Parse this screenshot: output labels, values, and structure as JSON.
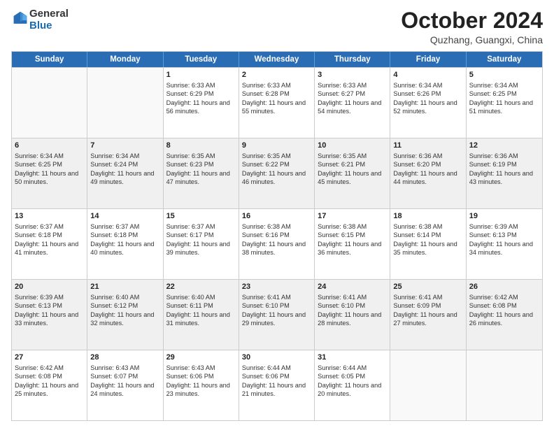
{
  "header": {
    "logo": {
      "general": "General",
      "blue": "Blue"
    },
    "title": "October 2024",
    "subtitle": "Quzhang, Guangxi, China"
  },
  "weekdays": [
    "Sunday",
    "Monday",
    "Tuesday",
    "Wednesday",
    "Thursday",
    "Friday",
    "Saturday"
  ],
  "weeks": [
    [
      {
        "day": "",
        "sunrise": "",
        "sunset": "",
        "daylight": "",
        "empty": true
      },
      {
        "day": "",
        "sunrise": "",
        "sunset": "",
        "daylight": "",
        "empty": true
      },
      {
        "day": "1",
        "sunrise": "Sunrise: 6:33 AM",
        "sunset": "Sunset: 6:29 PM",
        "daylight": "Daylight: 11 hours and 56 minutes.",
        "empty": false
      },
      {
        "day": "2",
        "sunrise": "Sunrise: 6:33 AM",
        "sunset": "Sunset: 6:28 PM",
        "daylight": "Daylight: 11 hours and 55 minutes.",
        "empty": false
      },
      {
        "day": "3",
        "sunrise": "Sunrise: 6:33 AM",
        "sunset": "Sunset: 6:27 PM",
        "daylight": "Daylight: 11 hours and 54 minutes.",
        "empty": false
      },
      {
        "day": "4",
        "sunrise": "Sunrise: 6:34 AM",
        "sunset": "Sunset: 6:26 PM",
        "daylight": "Daylight: 11 hours and 52 minutes.",
        "empty": false
      },
      {
        "day": "5",
        "sunrise": "Sunrise: 6:34 AM",
        "sunset": "Sunset: 6:25 PM",
        "daylight": "Daylight: 11 hours and 51 minutes.",
        "empty": false
      }
    ],
    [
      {
        "day": "6",
        "sunrise": "Sunrise: 6:34 AM",
        "sunset": "Sunset: 6:25 PM",
        "daylight": "Daylight: 11 hours and 50 minutes.",
        "empty": false
      },
      {
        "day": "7",
        "sunrise": "Sunrise: 6:34 AM",
        "sunset": "Sunset: 6:24 PM",
        "daylight": "Daylight: 11 hours and 49 minutes.",
        "empty": false
      },
      {
        "day": "8",
        "sunrise": "Sunrise: 6:35 AM",
        "sunset": "Sunset: 6:23 PM",
        "daylight": "Daylight: 11 hours and 47 minutes.",
        "empty": false
      },
      {
        "day": "9",
        "sunrise": "Sunrise: 6:35 AM",
        "sunset": "Sunset: 6:22 PM",
        "daylight": "Daylight: 11 hours and 46 minutes.",
        "empty": false
      },
      {
        "day": "10",
        "sunrise": "Sunrise: 6:35 AM",
        "sunset": "Sunset: 6:21 PM",
        "daylight": "Daylight: 11 hours and 45 minutes.",
        "empty": false
      },
      {
        "day": "11",
        "sunrise": "Sunrise: 6:36 AM",
        "sunset": "Sunset: 6:20 PM",
        "daylight": "Daylight: 11 hours and 44 minutes.",
        "empty": false
      },
      {
        "day": "12",
        "sunrise": "Sunrise: 6:36 AM",
        "sunset": "Sunset: 6:19 PM",
        "daylight": "Daylight: 11 hours and 43 minutes.",
        "empty": false
      }
    ],
    [
      {
        "day": "13",
        "sunrise": "Sunrise: 6:37 AM",
        "sunset": "Sunset: 6:18 PM",
        "daylight": "Daylight: 11 hours and 41 minutes.",
        "empty": false
      },
      {
        "day": "14",
        "sunrise": "Sunrise: 6:37 AM",
        "sunset": "Sunset: 6:18 PM",
        "daylight": "Daylight: 11 hours and 40 minutes.",
        "empty": false
      },
      {
        "day": "15",
        "sunrise": "Sunrise: 6:37 AM",
        "sunset": "Sunset: 6:17 PM",
        "daylight": "Daylight: 11 hours and 39 minutes.",
        "empty": false
      },
      {
        "day": "16",
        "sunrise": "Sunrise: 6:38 AM",
        "sunset": "Sunset: 6:16 PM",
        "daylight": "Daylight: 11 hours and 38 minutes.",
        "empty": false
      },
      {
        "day": "17",
        "sunrise": "Sunrise: 6:38 AM",
        "sunset": "Sunset: 6:15 PM",
        "daylight": "Daylight: 11 hours and 36 minutes.",
        "empty": false
      },
      {
        "day": "18",
        "sunrise": "Sunrise: 6:38 AM",
        "sunset": "Sunset: 6:14 PM",
        "daylight": "Daylight: 11 hours and 35 minutes.",
        "empty": false
      },
      {
        "day": "19",
        "sunrise": "Sunrise: 6:39 AM",
        "sunset": "Sunset: 6:13 PM",
        "daylight": "Daylight: 11 hours and 34 minutes.",
        "empty": false
      }
    ],
    [
      {
        "day": "20",
        "sunrise": "Sunrise: 6:39 AM",
        "sunset": "Sunset: 6:13 PM",
        "daylight": "Daylight: 11 hours and 33 minutes.",
        "empty": false
      },
      {
        "day": "21",
        "sunrise": "Sunrise: 6:40 AM",
        "sunset": "Sunset: 6:12 PM",
        "daylight": "Daylight: 11 hours and 32 minutes.",
        "empty": false
      },
      {
        "day": "22",
        "sunrise": "Sunrise: 6:40 AM",
        "sunset": "Sunset: 6:11 PM",
        "daylight": "Daylight: 11 hours and 31 minutes.",
        "empty": false
      },
      {
        "day": "23",
        "sunrise": "Sunrise: 6:41 AM",
        "sunset": "Sunset: 6:10 PM",
        "daylight": "Daylight: 11 hours and 29 minutes.",
        "empty": false
      },
      {
        "day": "24",
        "sunrise": "Sunrise: 6:41 AM",
        "sunset": "Sunset: 6:10 PM",
        "daylight": "Daylight: 11 hours and 28 minutes.",
        "empty": false
      },
      {
        "day": "25",
        "sunrise": "Sunrise: 6:41 AM",
        "sunset": "Sunset: 6:09 PM",
        "daylight": "Daylight: 11 hours and 27 minutes.",
        "empty": false
      },
      {
        "day": "26",
        "sunrise": "Sunrise: 6:42 AM",
        "sunset": "Sunset: 6:08 PM",
        "daylight": "Daylight: 11 hours and 26 minutes.",
        "empty": false
      }
    ],
    [
      {
        "day": "27",
        "sunrise": "Sunrise: 6:42 AM",
        "sunset": "Sunset: 6:08 PM",
        "daylight": "Daylight: 11 hours and 25 minutes.",
        "empty": false
      },
      {
        "day": "28",
        "sunrise": "Sunrise: 6:43 AM",
        "sunset": "Sunset: 6:07 PM",
        "daylight": "Daylight: 11 hours and 24 minutes.",
        "empty": false
      },
      {
        "day": "29",
        "sunrise": "Sunrise: 6:43 AM",
        "sunset": "Sunset: 6:06 PM",
        "daylight": "Daylight: 11 hours and 23 minutes.",
        "empty": false
      },
      {
        "day": "30",
        "sunrise": "Sunrise: 6:44 AM",
        "sunset": "Sunset: 6:06 PM",
        "daylight": "Daylight: 11 hours and 21 minutes.",
        "empty": false
      },
      {
        "day": "31",
        "sunrise": "Sunrise: 6:44 AM",
        "sunset": "Sunset: 6:05 PM",
        "daylight": "Daylight: 11 hours and 20 minutes.",
        "empty": false
      },
      {
        "day": "",
        "sunrise": "",
        "sunset": "",
        "daylight": "",
        "empty": true
      },
      {
        "day": "",
        "sunrise": "",
        "sunset": "",
        "daylight": "",
        "empty": true
      }
    ]
  ]
}
